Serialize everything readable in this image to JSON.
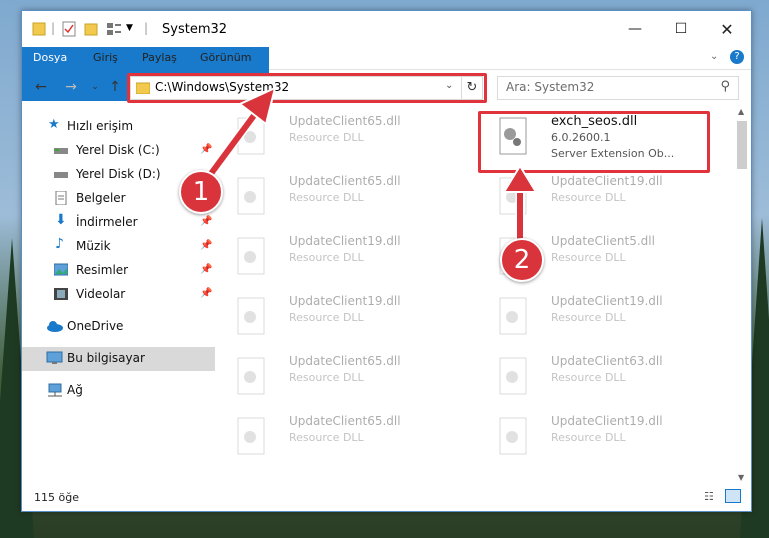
{
  "window": {
    "title": "System32"
  },
  "ribbon": {
    "tabs": [
      "Dosya",
      "Giriş",
      "Paylaş",
      "Görünüm"
    ]
  },
  "address": {
    "path": "C:\\Windows\\System32"
  },
  "search": {
    "placeholder": "Ara: System32"
  },
  "sidebar": {
    "items": [
      {
        "label": "Hızlı erişim",
        "icon": "star-icon",
        "pinned": false
      },
      {
        "label": "Yerel Disk (C:)",
        "icon": "drive-icon",
        "pinned": true
      },
      {
        "label": "Yerel Disk (D:)",
        "icon": "drive-icon",
        "pinned": false
      },
      {
        "label": "Belgeler",
        "icon": "document-icon",
        "pinned": false
      },
      {
        "label": "İndirmeler",
        "icon": "download-icon",
        "pinned": true
      },
      {
        "label": "Müzik",
        "icon": "music-icon",
        "pinned": true
      },
      {
        "label": "Resimler",
        "icon": "pictures-icon",
        "pinned": true
      },
      {
        "label": "Videolar",
        "icon": "video-icon",
        "pinned": true
      },
      {
        "label": "OneDrive",
        "icon": "cloud-icon",
        "pinned": false
      },
      {
        "label": "Bu bilgisayar",
        "icon": "computer-icon",
        "pinned": false
      },
      {
        "label": "Ağ",
        "icon": "network-icon",
        "pinned": false
      }
    ]
  },
  "files": [
    {
      "name": "UpdateClient65.dll",
      "desc": "Resource DLL",
      "faded": true
    },
    {
      "name": "exch_seos.dll",
      "version": "6.0.2600.1",
      "desc": "Server Extension Ob...",
      "faded": false
    },
    {
      "name": "UpdateClient65.dll",
      "desc": "Resource DLL",
      "faded": true
    },
    {
      "name": "UpdateClient19.dll",
      "desc": "Resource DLL",
      "faded": true
    },
    {
      "name": "UpdateClient19.dll",
      "desc": "Resource DLL",
      "faded": true
    },
    {
      "name": "UpdateClient5.dll",
      "desc": "Resource DLL",
      "faded": true
    },
    {
      "name": "UpdateClient19.dll",
      "desc": "Resource DLL",
      "faded": true
    },
    {
      "name": "UpdateClient19.dll",
      "desc": "Resource DLL",
      "faded": true
    },
    {
      "name": "UpdateClient65.dll",
      "desc": "Resource DLL",
      "faded": true
    },
    {
      "name": "UpdateClient63.dll",
      "desc": "Resource DLL",
      "faded": true
    },
    {
      "name": "UpdateClient65.dll",
      "desc": "Resource DLL",
      "faded": true
    },
    {
      "name": "UpdateClient19.dll",
      "desc": "Resource DLL",
      "faded": true
    }
  ],
  "status": {
    "count": "115 öğe"
  },
  "annotations": {
    "marker1": "1",
    "marker2": "2"
  },
  "colors": {
    "accent": "#1979ca",
    "highlight": "#e0333c",
    "marker": "#d9343b"
  }
}
